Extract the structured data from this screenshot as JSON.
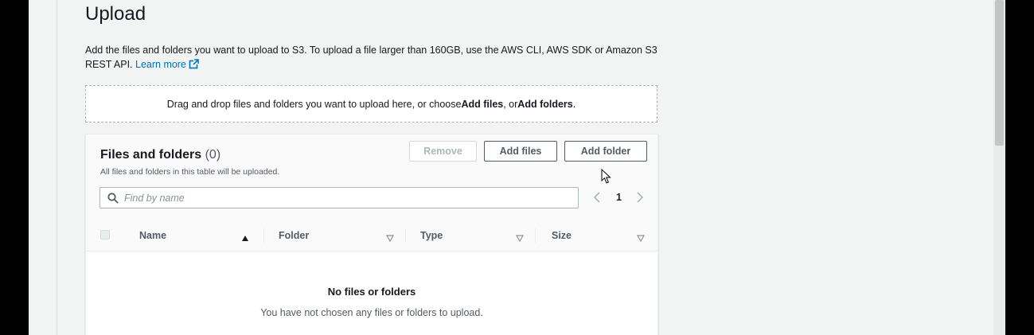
{
  "page": {
    "title": "Upload",
    "description": "Add the files and folders you want to upload to S3. To upload a file larger than 160GB, use the AWS CLI, AWS SDK or Amazon S3 REST API.",
    "learn_more": "Learn more",
    "learn_more_icon": "external-link-icon"
  },
  "dropzone": {
    "text_before": "Drag and drop files and folders you want to upload here, or choose ",
    "add_files": "Add files",
    "separator": ", or ",
    "add_folders": "Add folders",
    "text_after": "."
  },
  "files_panel": {
    "title": "Files and folders",
    "count": "(0)",
    "subtitle": "All files and folders in this table will be uploaded.",
    "buttons": {
      "remove": "Remove",
      "add_files": "Add files",
      "add_folder": "Add folder"
    },
    "search": {
      "placeholder": "Find by name",
      "value": "",
      "icon": "search-icon"
    },
    "pagination": {
      "current_page": "1"
    },
    "columns": [
      {
        "label": "Name",
        "sort": "ascending"
      },
      {
        "label": "Folder",
        "sort": "none"
      },
      {
        "label": "Type",
        "sort": "none"
      },
      {
        "label": "Size",
        "sort": "none"
      }
    ],
    "empty": {
      "title": "No files or folders",
      "message": "You have not chosen any files or folders to upload."
    }
  },
  "colors": {
    "link": "#0073bb",
    "text": "#16191f",
    "secondary_text": "#545b64",
    "background": "#f2f3f3",
    "disabled": "#aab7b8"
  }
}
